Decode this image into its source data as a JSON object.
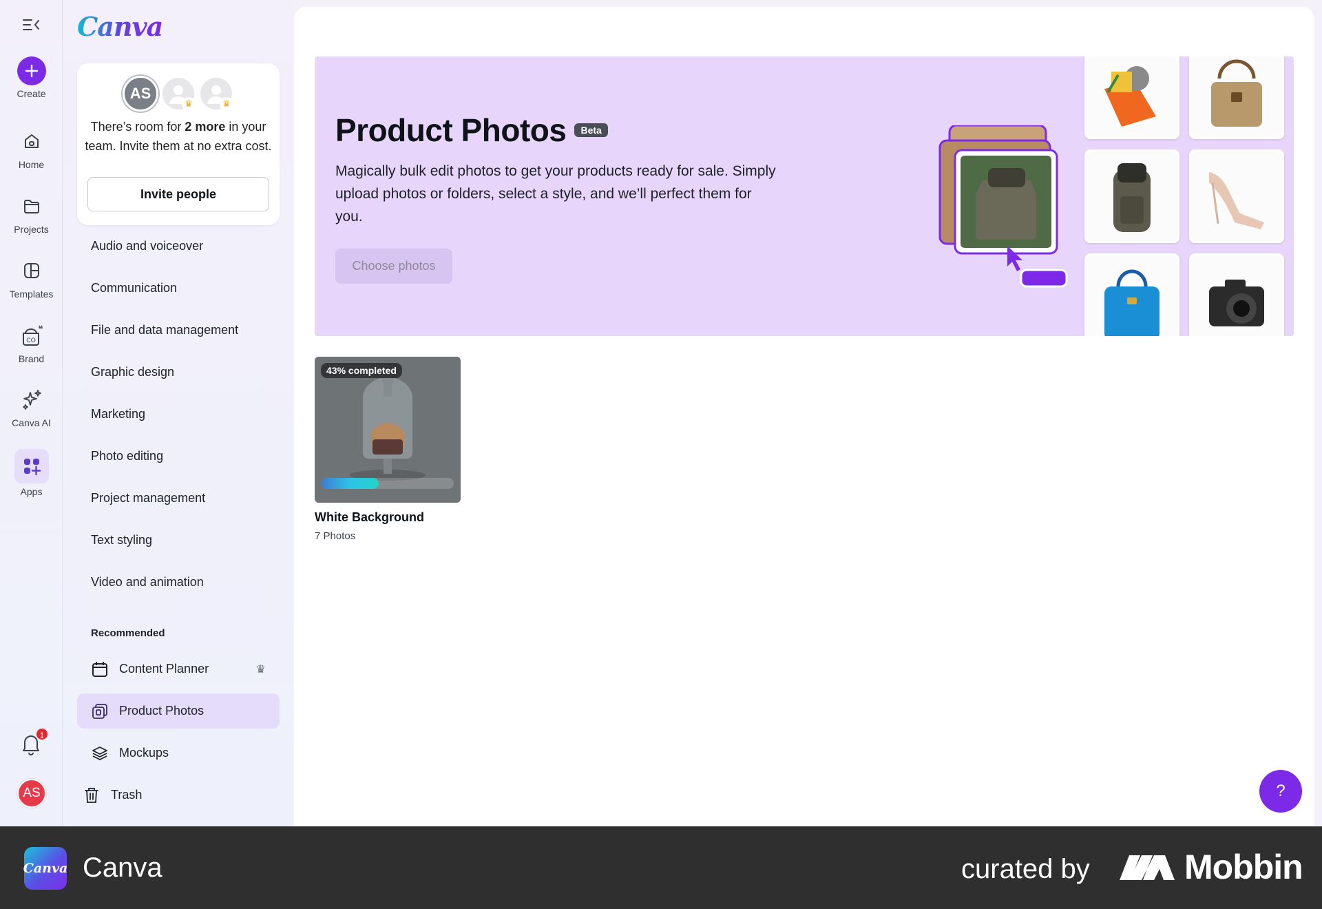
{
  "rail": {
    "create_label": "Create",
    "items": [
      {
        "label": "Home",
        "icon": "home-icon"
      },
      {
        "label": "Projects",
        "icon": "folder-icon"
      },
      {
        "label": "Templates",
        "icon": "templates-icon"
      },
      {
        "label": "Brand",
        "icon": "brand-icon"
      },
      {
        "label": "Canva AI",
        "icon": "sparkles-icon"
      },
      {
        "label": "Apps",
        "icon": "apps-icon"
      }
    ],
    "notification_count": "1",
    "avatar_initials": "AS"
  },
  "panel": {
    "logo_text": "Canva",
    "team": {
      "avatar_initials": "AS",
      "text_pre": "There’s room for ",
      "text_bold": "2 more",
      "text_post": " in your team. Invite them at no extra cost.",
      "invite_label": "Invite people"
    },
    "categories": [
      "Audio and voiceover",
      "Communication",
      "File and data management",
      "Graphic design",
      "Marketing",
      "Photo editing",
      "Project management",
      "Text styling",
      "Video and animation"
    ],
    "recommended_heading": "Recommended",
    "recommended": [
      {
        "label": "Content Planner"
      },
      {
        "label": "Product Photos"
      },
      {
        "label": "Mockups"
      }
    ],
    "trash_label": "Trash"
  },
  "hero": {
    "title": "Product Photos",
    "badge": "Beta",
    "description": "Magically bulk edit photos to get your products ready for sale. Simply upload photos or folders, select a style, and we’ll perfect them for you.",
    "cta": "Choose photos"
  },
  "project": {
    "status": "43% completed",
    "progress": 0.43,
    "title": "White Background",
    "subtitle": "7 Photos"
  },
  "help_label": "?",
  "footer": {
    "app_name": "Canva",
    "logo_text": "Canva",
    "curated_by": "curated by",
    "brand": "Mobbin"
  },
  "colors": {
    "accent": "#7d2ae8",
    "hero_bg": "#e8d5fb",
    "active_item": "#e5dcfb",
    "badge_red": "#e0262f"
  }
}
